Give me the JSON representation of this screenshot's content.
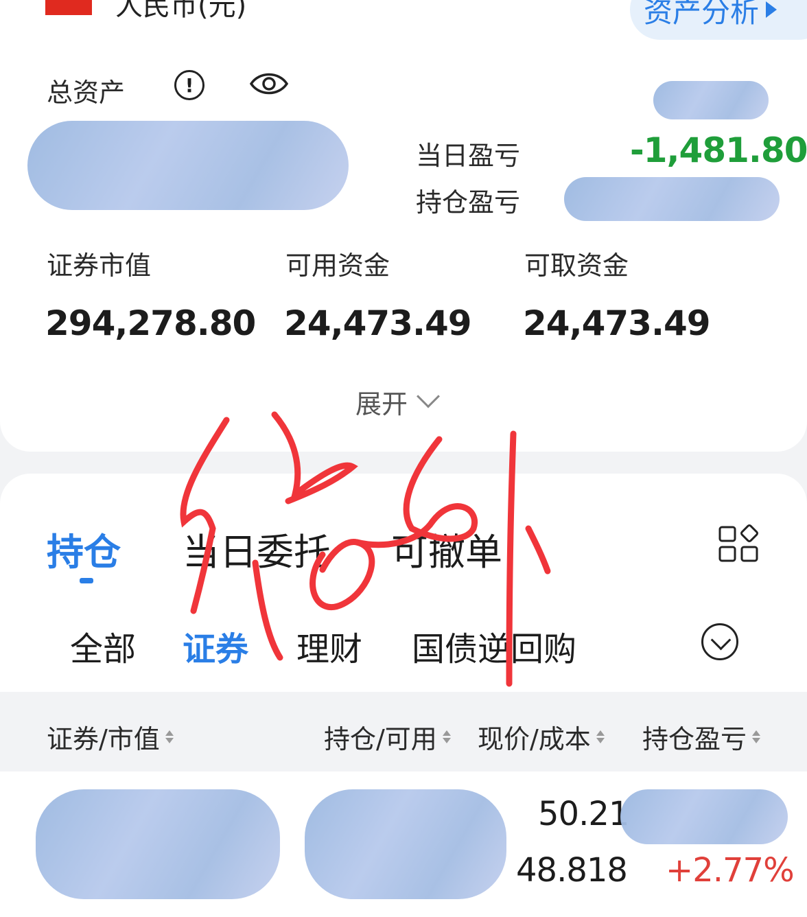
{
  "header": {
    "currency": "人民币(元)",
    "analysis_button": "资产分析"
  },
  "account": {
    "total_assets_label": "总资产",
    "info_icon": "info-icon",
    "eye_icon": "eye-icon",
    "daily_pl_label": "当日盈亏",
    "daily_pl_value": "-1,481.80",
    "position_pl_label": "持仓盈亏",
    "securities_value_label": "证券市值",
    "securities_value": "294,278.80",
    "available_funds_label": "可用资金",
    "available_funds": "24,473.49",
    "withdrawable_funds_label": "可取资金",
    "withdrawable_funds": "24,473.49",
    "expand_label": "展开"
  },
  "tabs": [
    {
      "label": "持仓"
    },
    {
      "label": "当日委托"
    },
    {
      "label": "可撤单"
    }
  ],
  "subtabs": [
    {
      "label": "全部"
    },
    {
      "label": "证券"
    },
    {
      "label": "理财"
    },
    {
      "label": "国债逆回购"
    }
  ],
  "table": {
    "headers": [
      "证券/市值",
      "持仓/可用",
      "现价/成本",
      "持仓盈亏"
    ],
    "rows": [
      {
        "price": "50.21",
        "cost": "48.818",
        "pl_pct": "+2.77%"
      }
    ]
  },
  "colors": {
    "accent": "#2a7ee6",
    "gain": "#e0403a",
    "loss": "#1f9e3a"
  }
}
